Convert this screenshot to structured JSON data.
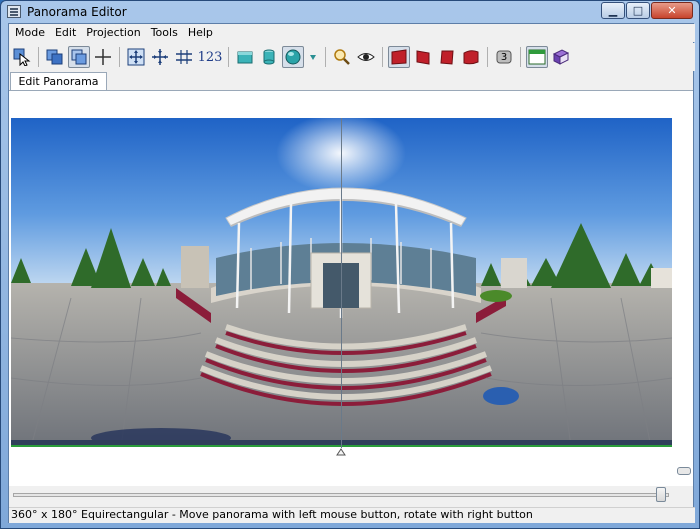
{
  "window": {
    "title": "Panorama Editor"
  },
  "menu": [
    "Mode",
    "Edit",
    "Projection",
    "Tools",
    "Help"
  ],
  "toolbar": {
    "number_button_label": "123",
    "counter_badge": "3"
  },
  "tabs": [
    {
      "label": "Edit Panorama",
      "active": true
    }
  ],
  "status": {
    "text": "360° x 180° Equirectangular - Move panorama with left mouse button, rotate with right button"
  },
  "colors": {
    "sky_top": "#1f63c6",
    "sky_bottom": "#9cc6ef",
    "ground": "#8a9097",
    "steps": "#8b1d3a",
    "canopy": "#f2f2f2"
  }
}
